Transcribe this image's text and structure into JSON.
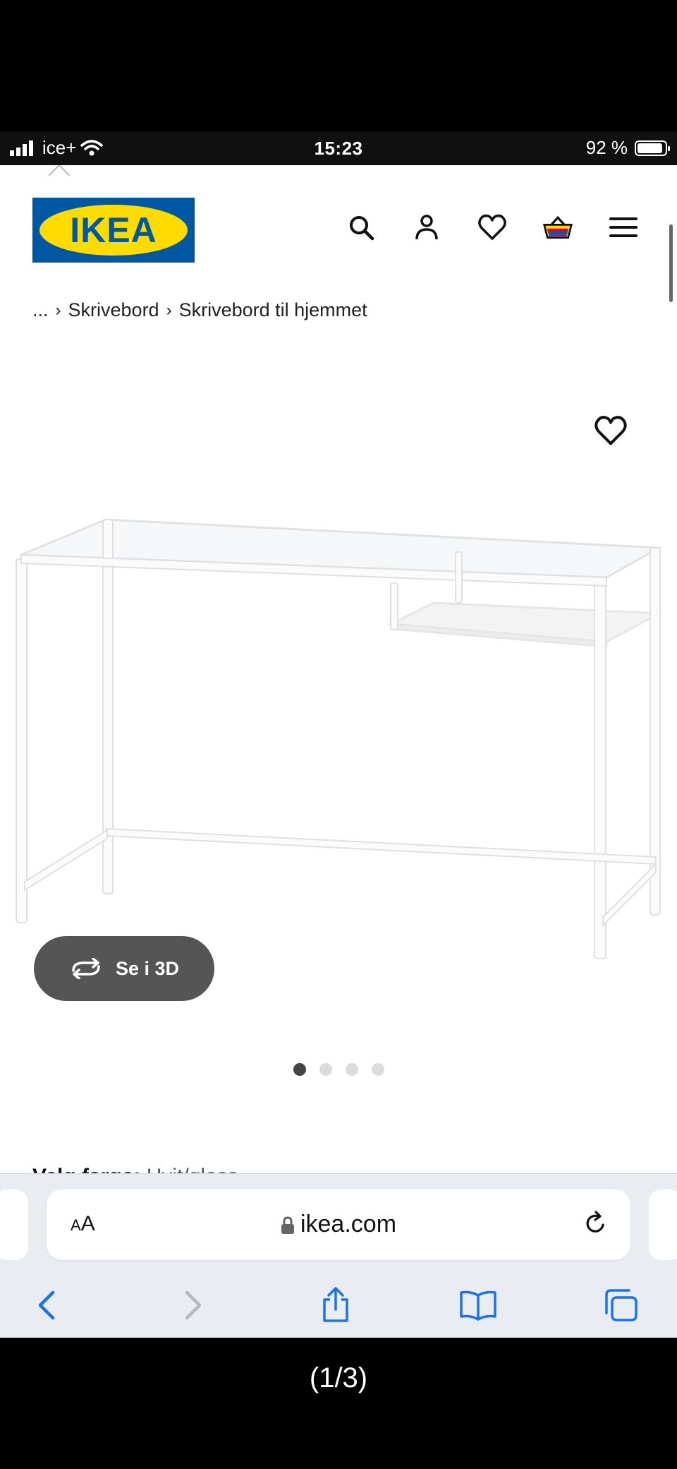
{
  "status_bar": {
    "carrier": "ice+",
    "time": "15:23",
    "battery": "92 %",
    "battery_level": 0.92
  },
  "header": {
    "logo_text": "IKEA",
    "icons": [
      "search-icon",
      "profile-icon",
      "heart-icon",
      "basket-icon",
      "menu-icon"
    ]
  },
  "breadcrumb": {
    "ellipsis": "...",
    "items": [
      "Skrivebord",
      "Skrivebord til hjemmet"
    ]
  },
  "product": {
    "view_3d_label": "Se i 3D",
    "carousel_count": 4,
    "carousel_active": 1,
    "color_label": "Velg farge:",
    "color_value": "Hvit/glass"
  },
  "safari": {
    "text_size_label": "AA",
    "url": "ikea.com"
  },
  "caption": "(1/3)",
  "colors": {
    "ikea_blue": "#0058a3",
    "ikea_yellow": "#ffdb00",
    "button_3d": "#555555",
    "safari_blue": "#1a73e8"
  }
}
